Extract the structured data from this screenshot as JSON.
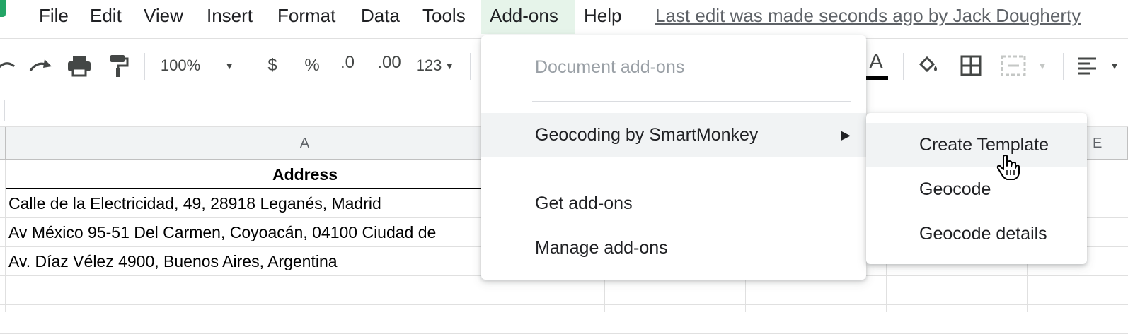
{
  "menubar": {
    "items": [
      {
        "label": "File"
      },
      {
        "label": "Edit"
      },
      {
        "label": "View"
      },
      {
        "label": "Insert"
      },
      {
        "label": "Format"
      },
      {
        "label": "Data"
      },
      {
        "label": "Tools"
      },
      {
        "label": "Add-ons"
      },
      {
        "label": "Help"
      }
    ],
    "last_edit": "Last edit was made seconds ago by Jack Dougherty"
  },
  "toolbar": {
    "zoom": "100%",
    "currency": "$",
    "percent": "%",
    "decrease_decimal": ".0",
    "increase_decimal": ".00",
    "more_formats": "123",
    "text_color_letter": "A"
  },
  "grid": {
    "column_headers": [
      "A",
      "E"
    ],
    "header_cell": "Address",
    "rows": [
      "Calle de la Electricidad, 49, 28918 Leganés, Madrid",
      "Av México 95-51 Del Carmen, Coyoacán, 04100 Ciudad de",
      "Av. Díaz Vélez 4900, Buenos Aires, Argentina"
    ]
  },
  "addons_menu": {
    "section_label": "Document add-ons",
    "addon_item": "Geocoding by SmartMonkey",
    "get_addons": "Get add-ons",
    "manage_addons": "Manage add-ons"
  },
  "submenu": {
    "items": [
      "Create Template",
      "Geocode",
      "Geocode details"
    ]
  },
  "colors": {
    "active_menu_bg": "#e6f4ea",
    "hover_bg": "#f1f3f4",
    "sheets_green": "#23a566"
  }
}
